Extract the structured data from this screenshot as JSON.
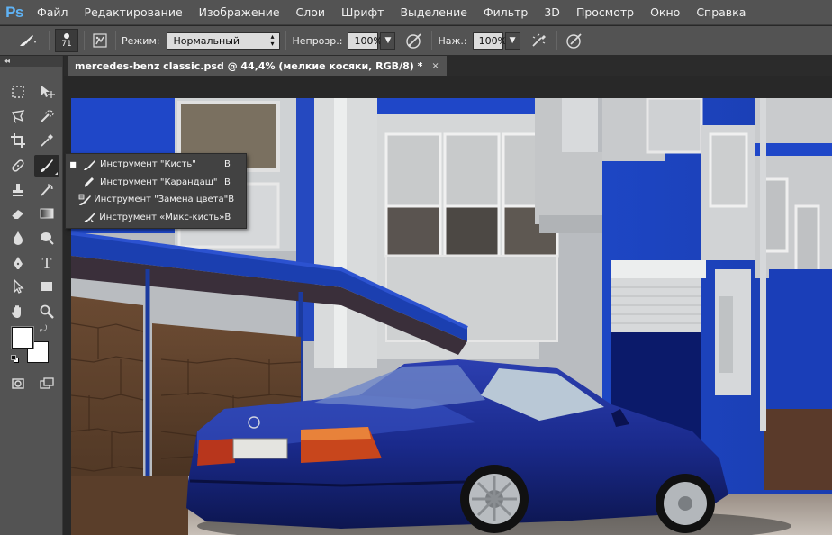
{
  "app": {
    "logo": "Ps"
  },
  "menu": [
    "Файл",
    "Редактирование",
    "Изображение",
    "Слои",
    "Шрифт",
    "Выделение",
    "Фильтр",
    "3D",
    "Просмотр",
    "Окно",
    "Справка"
  ],
  "options": {
    "brush_size": "71",
    "mode_label": "Режим:",
    "mode_value": "Нормальный",
    "opacity_label": "Непрозр.:",
    "opacity_value": "100%",
    "pressure_label": "Наж.:",
    "pressure_value": "100%"
  },
  "document": {
    "tab_title": "mercedes-benz classic.psd @ 44,4% (мелкие косяки, RGB/8) *",
    "close_glyph": "×"
  },
  "toolbox": {
    "collapse_glyph": "◂◂",
    "type_tool_glyph": "T"
  },
  "brush_flyout": [
    {
      "label": "Инструмент \"Кисть\"",
      "key": "B",
      "icon": "brush-icon",
      "selected": true
    },
    {
      "label": "Инструмент \"Карандаш\"",
      "key": "B",
      "icon": "pencil-icon",
      "selected": false
    },
    {
      "label": "Инструмент \"Замена цвета\"",
      "key": "B",
      "icon": "color-replacement-icon",
      "selected": false
    },
    {
      "label": "Инструмент «Микс-кисть»",
      "key": "B",
      "icon": "mixer-brush-icon",
      "selected": false
    }
  ],
  "colors": {
    "foreground": "#ffffff",
    "background": "#ffffff",
    "ps_blue": "#5fb3f6",
    "panel": "#535353"
  }
}
